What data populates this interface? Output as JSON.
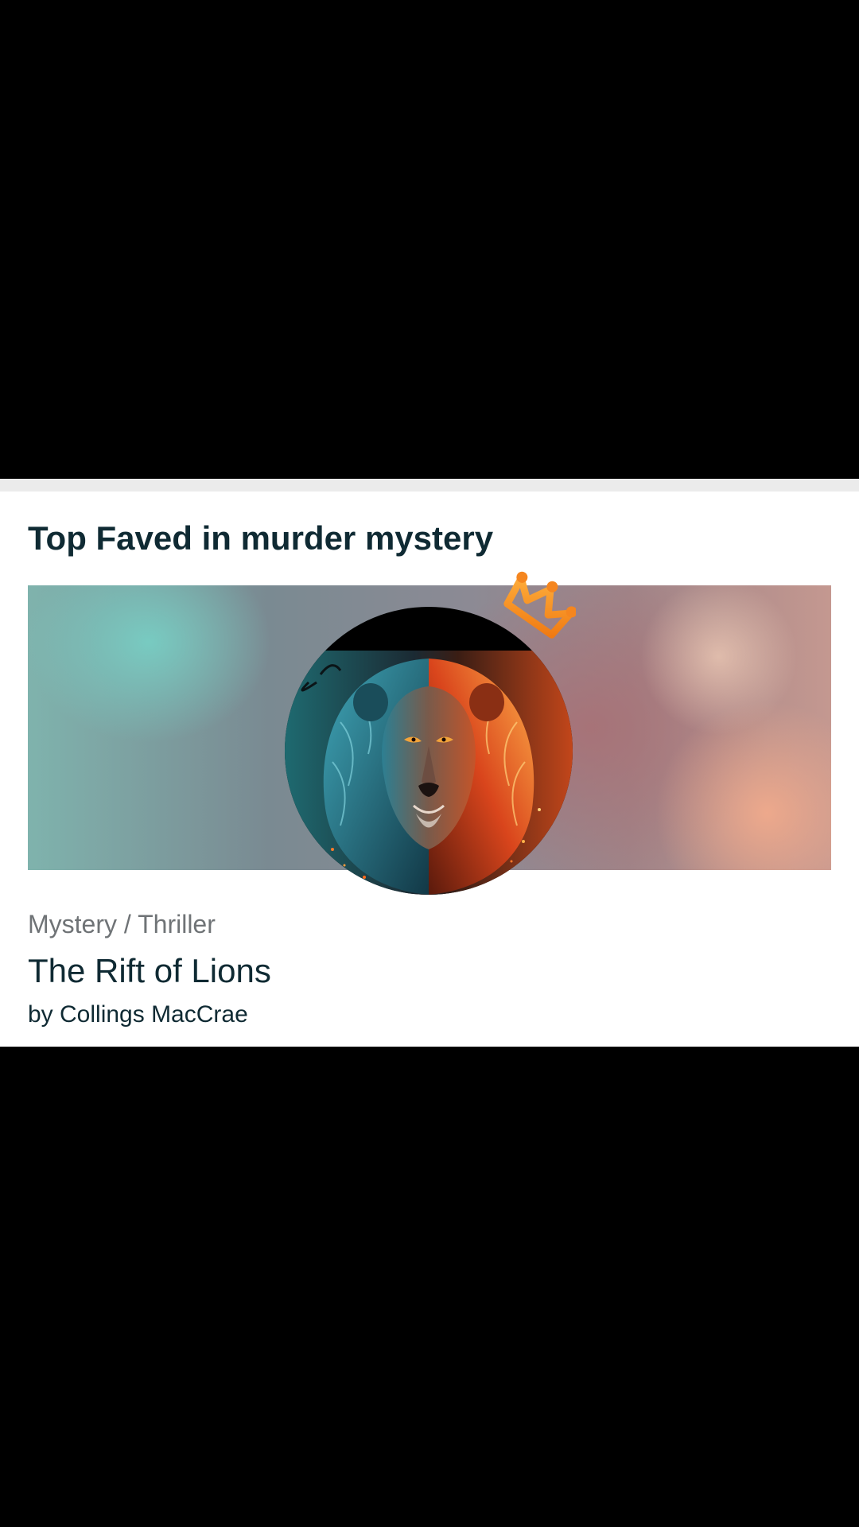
{
  "section": {
    "title": "Top Faved in murder mystery"
  },
  "book": {
    "genre": "Mystery / Thriller",
    "title": "The Rift of Lions",
    "author": "by Collings MacCrae"
  },
  "icons": {
    "crown": "crown-icon",
    "cover": "lion-cover-image"
  },
  "colors": {
    "title_text": "#0f2a33",
    "genre_text": "#6f7376",
    "crown": "#f5861f",
    "card_background": "#ffffff",
    "separator": "#ebebeb"
  }
}
